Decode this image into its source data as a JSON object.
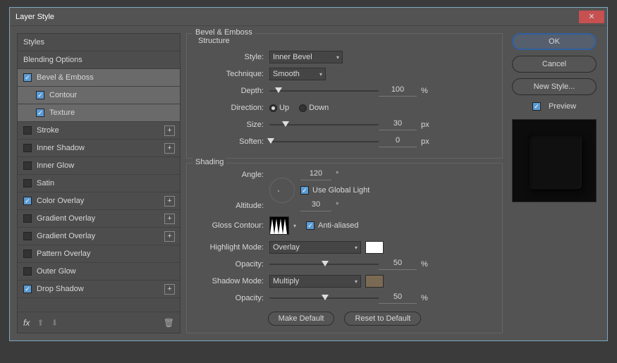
{
  "window": {
    "title": "Layer Style"
  },
  "sidebar": {
    "items": [
      {
        "label": "Styles",
        "checked": null,
        "plus": false,
        "indent": false
      },
      {
        "label": "Blending Options",
        "checked": null,
        "plus": false,
        "indent": false
      },
      {
        "label": "Bevel & Emboss",
        "checked": true,
        "plus": false,
        "indent": false,
        "selected": true
      },
      {
        "label": "Contour",
        "checked": true,
        "plus": false,
        "indent": true
      },
      {
        "label": "Texture",
        "checked": true,
        "plus": false,
        "indent": true
      },
      {
        "label": "Stroke",
        "checked": false,
        "plus": true,
        "indent": false
      },
      {
        "label": "Inner Shadow",
        "checked": false,
        "plus": true,
        "indent": false
      },
      {
        "label": "Inner Glow",
        "checked": false,
        "plus": false,
        "indent": false
      },
      {
        "label": "Satin",
        "checked": false,
        "plus": false,
        "indent": false
      },
      {
        "label": "Color Overlay",
        "checked": true,
        "plus": true,
        "indent": false
      },
      {
        "label": "Gradient Overlay",
        "checked": false,
        "plus": true,
        "indent": false
      },
      {
        "label": "Gradient Overlay",
        "checked": false,
        "plus": true,
        "indent": false
      },
      {
        "label": "Pattern Overlay",
        "checked": false,
        "plus": false,
        "indent": false
      },
      {
        "label": "Outer Glow",
        "checked": false,
        "plus": false,
        "indent": false
      },
      {
        "label": "Drop Shadow",
        "checked": true,
        "plus": true,
        "indent": false
      }
    ],
    "footer_fx": "fx"
  },
  "panel": {
    "title": "Bevel & Emboss",
    "structure": {
      "legend": "Structure",
      "style_label": "Style:",
      "style_value": "Inner Bevel",
      "technique_label": "Technique:",
      "technique_value": "Smooth",
      "depth_label": "Depth:",
      "depth_value": "100",
      "depth_unit": "%",
      "direction_label": "Direction:",
      "up": "Up",
      "down": "Down",
      "size_label": "Size:",
      "size_value": "30",
      "size_unit": "px",
      "soften_label": "Soften:",
      "soften_value": "0",
      "soften_unit": "px"
    },
    "shading": {
      "legend": "Shading",
      "angle_label": "Angle:",
      "angle_value": "120",
      "deg": "°",
      "global_label": "Use Global Light",
      "altitude_label": "Altitude:",
      "altitude_value": "30",
      "gloss_label": "Gloss Contour:",
      "aa_label": "Anti-aliased",
      "hl_mode_label": "Highlight Mode:",
      "hl_mode_value": "Overlay",
      "hl_color": "#ffffff",
      "opacity_label": "Opacity:",
      "hl_opacity": "50",
      "pct": "%",
      "sh_mode_label": "Shadow Mode:",
      "sh_mode_value": "Multiply",
      "sh_color": "#7b6a53",
      "sh_opacity": "50"
    },
    "make_default": "Make Default",
    "reset_default": "Reset to Default"
  },
  "right": {
    "ok": "OK",
    "cancel": "Cancel",
    "new_style": "New Style...",
    "preview": "Preview"
  }
}
